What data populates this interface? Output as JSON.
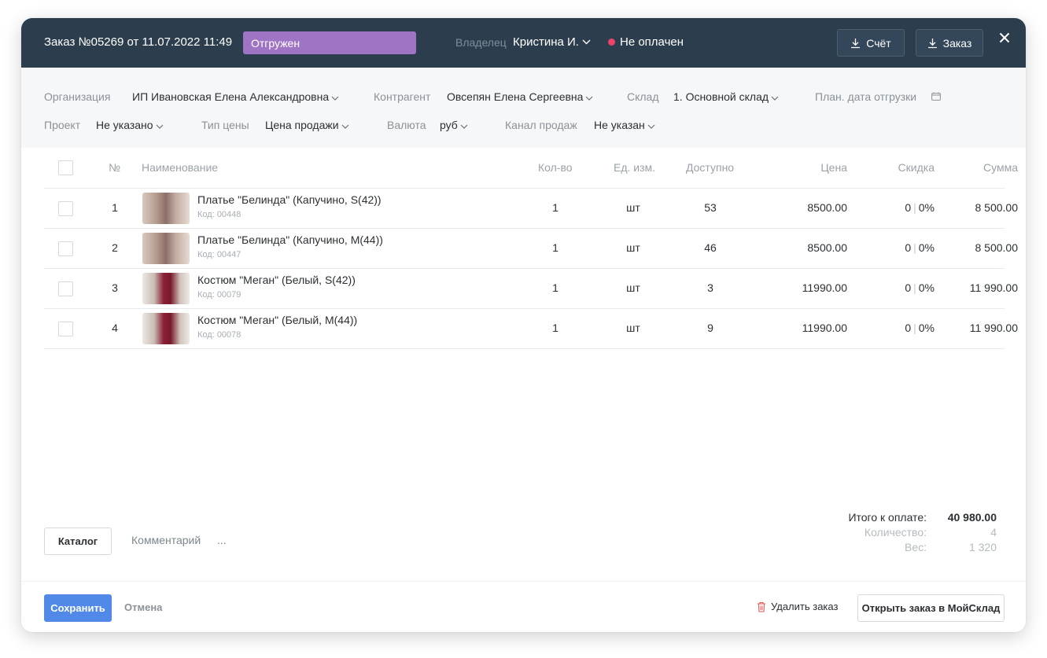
{
  "header": {
    "title": "Заказ №05269 от 11.07.2022 11:49",
    "status": "Отгружен",
    "status_color": "#a074c4",
    "owner_label": "Владелец",
    "owner_value": "Кристина И.",
    "payment_status": "Не оплачен",
    "payment_dot_color": "#f0426c",
    "invoice_button": "Счёт",
    "order_button": "Заказ",
    "close_icon": "close-icon"
  },
  "filters": {
    "organization": {
      "label": "Организация",
      "value": "ИП Ивановская Елена Александровна"
    },
    "counterparty": {
      "label": "Контрагент",
      "value": "Овсепян Елена Сергеевна"
    },
    "warehouse": {
      "label": "Склад",
      "value": "1. Основной склад"
    },
    "ship_date": {
      "label": "План. дата отгрузки",
      "icon": "calendar-icon"
    },
    "project": {
      "label": "Проект",
      "value": "Не указано"
    },
    "price_type": {
      "label": "Тип цены",
      "value": "Цена продажи"
    },
    "currency": {
      "label": "Валюта",
      "value": "руб"
    },
    "sales_channel": {
      "label": "Канал продаж",
      "value": "Не указан"
    }
  },
  "table": {
    "columns": {
      "num": "№",
      "name": "Наименование",
      "qty": "Кол-во",
      "unit": "Ед. изм.",
      "available": "Доступно",
      "price": "Цена",
      "discount": "Скидка",
      "sum": "Сумма"
    },
    "rows": [
      {
        "num": "1",
        "name": "Платье \"Белинда\" (Капучино, S(42))",
        "code": "Код: 00448",
        "qty": "1",
        "unit": "шт",
        "available": "53",
        "price": "8500.00",
        "disc_abs": "0",
        "disc_pct": "0%",
        "sum": "8 500.00"
      },
      {
        "num": "2",
        "name": "Платье \"Белинда\" (Капучино, M(44))",
        "code": "Код: 00447",
        "qty": "1",
        "unit": "шт",
        "available": "46",
        "price": "8500.00",
        "disc_abs": "0",
        "disc_pct": "0%",
        "sum": "8 500.00"
      },
      {
        "num": "3",
        "name": "Костюм \"Меган\" (Белый, S(42))",
        "code": "Код: 00079",
        "qty": "1",
        "unit": "шт",
        "available": "3",
        "price": "11990.00",
        "disc_abs": "0",
        "disc_pct": "0%",
        "sum": "11 990.00"
      },
      {
        "num": "4",
        "name": "Костюм \"Меган\" (Белый, M(44))",
        "code": "Код: 00078",
        "qty": "1",
        "unit": "шт",
        "available": "9",
        "price": "11990.00",
        "disc_abs": "0",
        "disc_pct": "0%",
        "sum": "11 990.00"
      }
    ]
  },
  "bottom": {
    "catalog_button": "Каталог",
    "comment_link": "Комментарий",
    "more": "...",
    "total_label": "Итого к оплате:",
    "total_value": "40 980.00",
    "quantity_label": "Количество:",
    "quantity_value": "4",
    "weight_label": "Вес:",
    "weight_value": "1 320"
  },
  "footer": {
    "save_button": "Сохранить",
    "cancel_button": "Отмена",
    "delete_link": "Удалить заказ",
    "open_button": "Открыть заказ в МойСклад"
  }
}
